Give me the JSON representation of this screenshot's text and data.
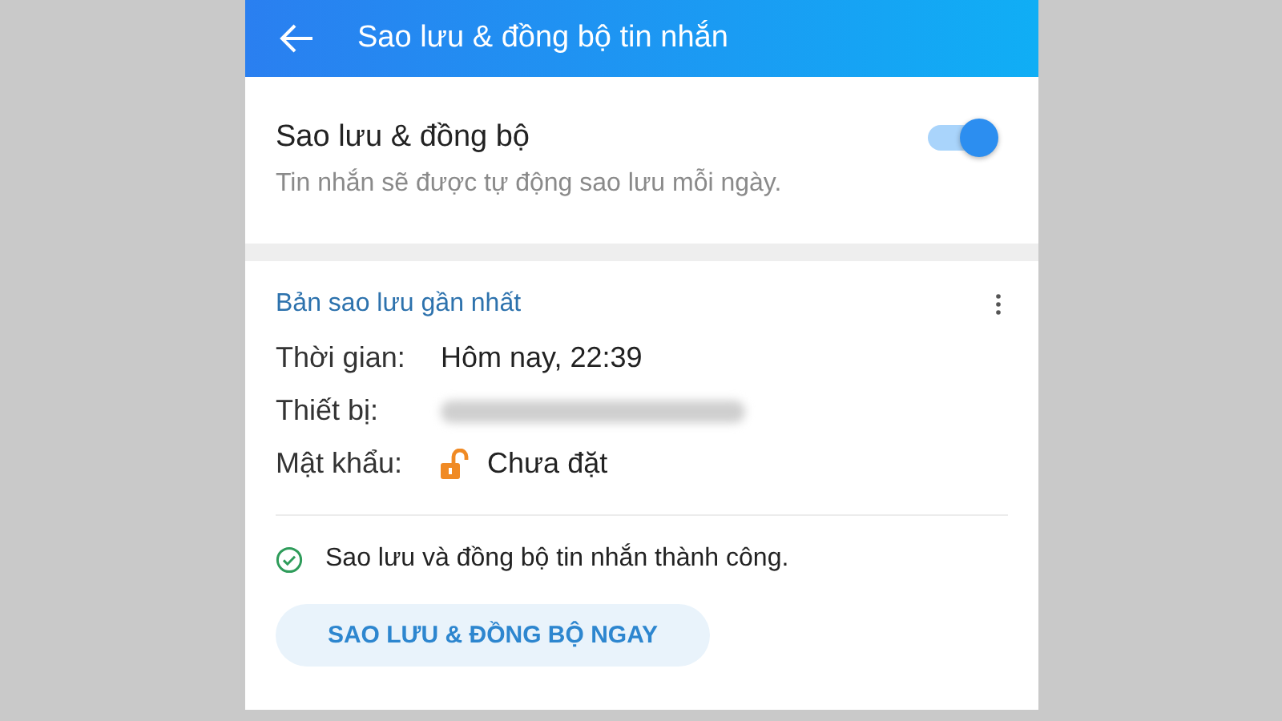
{
  "header": {
    "title": "Sao lưu & đồng bộ tin nhắn"
  },
  "backup_setting": {
    "label": "Sao lưu & đồng bộ",
    "description": "Tin nhắn sẽ được tự động sao lưu mỗi ngày.",
    "on": true
  },
  "latest_backup": {
    "title": "Bản sao lưu gần nhất",
    "fields": [
      {
        "kind": "text",
        "label": "Thời gian:",
        "value": "Hôm nay, 22:39"
      },
      {
        "kind": "redacted",
        "label": "Thiết bị:"
      },
      {
        "kind": "lock",
        "label": "Mật khẩu:",
        "value": "Chưa đặt"
      }
    ],
    "status": "Sao lưu và đồng bộ tin nhắn thành công.",
    "button": "SAO LƯU & ĐỒNG BỘ NGAY"
  }
}
